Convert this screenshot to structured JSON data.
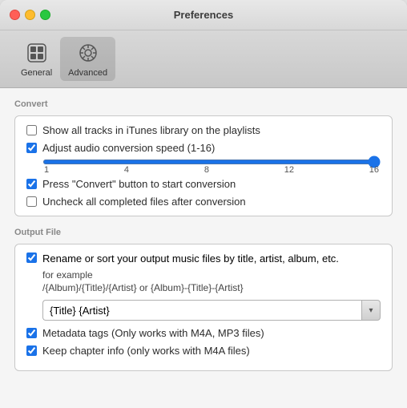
{
  "window": {
    "title": "Preferences"
  },
  "toolbar": {
    "general": {
      "label": "General",
      "active": false
    },
    "advanced": {
      "label": "Advanced",
      "active": true
    }
  },
  "convert_section": {
    "title": "Convert",
    "show_all_tracks": {
      "label": "Show all tracks in iTunes library on the playlists",
      "checked": false
    },
    "adjust_audio": {
      "label": "Adjust audio conversion speed (1-16)",
      "checked": true
    },
    "slider": {
      "min": 1,
      "max": 16,
      "value": 16,
      "ticks": [
        "1",
        "4",
        "8",
        "12",
        "16"
      ]
    },
    "press_convert": {
      "label": "Press \"Convert\" button to start conversion",
      "checked": true
    },
    "uncheck_completed": {
      "label": "Uncheck all completed files after conversion",
      "checked": false
    }
  },
  "output_section": {
    "title": "Output File",
    "rename": {
      "label": "Rename or sort your output music files by title, artist, album, etc.",
      "checked": true
    },
    "example_label": "for example",
    "example_format": "/{Album}/{Title}/{Artist} or {Album}-{Title}-{Artist}",
    "format_value": "{Title} {Artist}",
    "metadata": {
      "label": "Metadata tags (Only works with M4A, MP3 files)",
      "checked": true
    },
    "chapter": {
      "label": "Keep chapter info (only works with  M4A files)",
      "checked": true
    }
  },
  "icons": {
    "chevron_down": "▾"
  }
}
